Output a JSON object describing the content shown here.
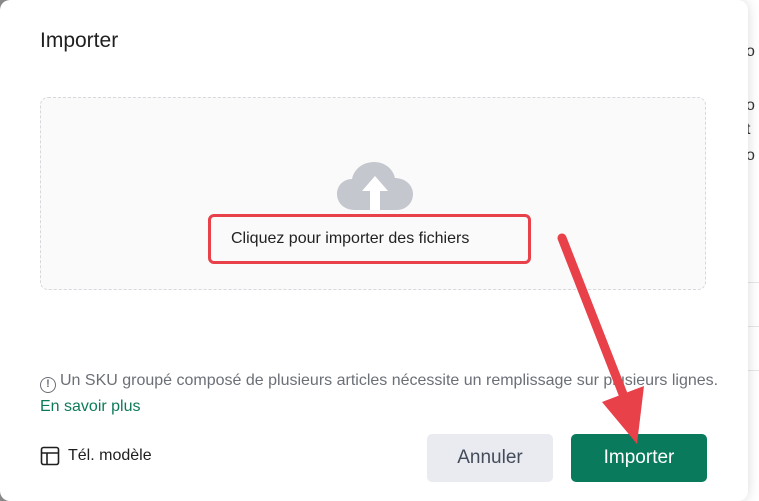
{
  "background": {
    "chars": [
      "o",
      "o",
      "t",
      "o"
    ]
  },
  "dialog": {
    "title": "Importer",
    "dropzone": {
      "icon": "cloud-upload-icon",
      "label": "Cliquez pour importer des fichiers"
    },
    "info": {
      "icon": "info-icon",
      "text_before": "Un SKU groupé composé de plusieurs articles nécessite un remplissage sur plusieurs lignes.",
      "learn_more": "En savoir plus"
    },
    "template": {
      "icon": "table-template-icon",
      "label": "Tél. modèle"
    },
    "buttons": {
      "cancel": "Annuler",
      "import": "Importer"
    }
  },
  "colors": {
    "primary": "#0a7a5c",
    "annotation": "#e8414a",
    "link": "#0f7a5a"
  }
}
